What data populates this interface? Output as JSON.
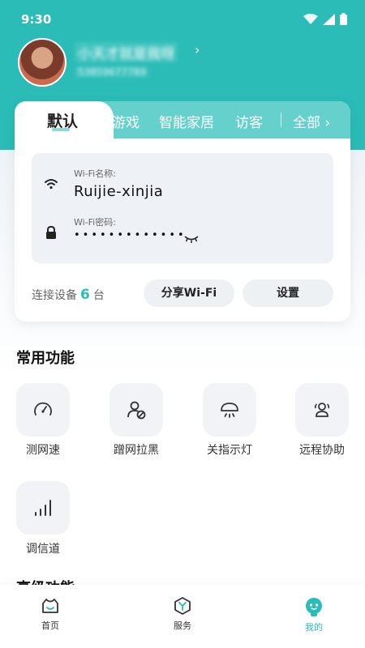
{
  "status_bar": {
    "time": "9:30"
  },
  "profile": {
    "name": "小天才就是我呀",
    "phone": "5385967778​9"
  },
  "card": {
    "tabs": [
      {
        "label": "默认",
        "active": true
      },
      {
        "label": "游戏",
        "active": false
      },
      {
        "label": "智能家居",
        "active": false
      },
      {
        "label": "访客",
        "active": false
      }
    ],
    "all_label": "全部 ›",
    "wifi_name_label": "Wi-Fi名称:",
    "wifi_name": "Ruijie-xinjia",
    "wifi_password_label": "Wi-Fi密码:",
    "wifi_password_mask": "•••••••••••••",
    "devices_prefix": "连接设备",
    "devices_count": "6",
    "devices_suffix": "台",
    "share_button": "分享Wi-Fi",
    "settings_button": "设置"
  },
  "common_functions": {
    "title": "常用功能",
    "items": [
      {
        "label": "测网速",
        "icon": "speedometer-icon"
      },
      {
        "label": "蹭网拉黑",
        "icon": "user-block-icon"
      },
      {
        "label": "关指示灯",
        "icon": "light-off-icon"
      },
      {
        "label": "远程协助",
        "icon": "remote-assist-icon"
      },
      {
        "label": "调信道",
        "icon": "signal-bars-icon"
      }
    ]
  },
  "next_section_title": "高级功能",
  "bottom_nav": [
    {
      "label": "首页",
      "icon": "home-icon",
      "active": false
    },
    {
      "label": "服务",
      "icon": "service-icon",
      "active": false
    },
    {
      "label": "我的",
      "icon": "mine-icon",
      "active": true
    }
  ],
  "colors": {
    "brand": "#2bbcb7",
    "tab_bar": "#66d1cc",
    "tile_bg": "#f1f3f6"
  }
}
